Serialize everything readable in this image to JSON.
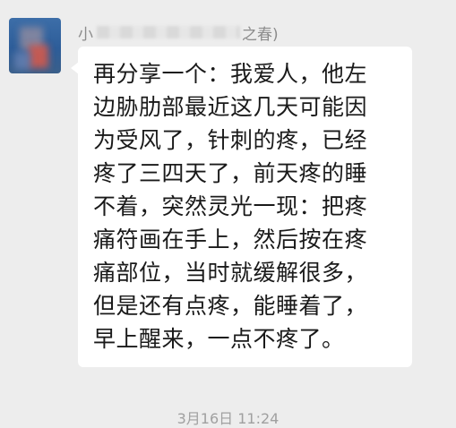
{
  "chat": {
    "sender": {
      "name_prefix": "小",
      "name_suffix": "之春)"
    },
    "message": {
      "lines": [
        "再分享一个：我爱人，他左",
        "边胁肋部最近这几天可能因",
        "为受风了，针刺的疼，已经",
        "疼了三四天了，前天疼的睡",
        "不着，突然灵光一现：把疼",
        "痛符画在手上，然后按在疼",
        "痛部位，当时就缓解很多，",
        "但是还有点疼，能睡着了，",
        "早上醒来，一点不疼了。"
      ]
    },
    "timestamp": "3月16日 11:24"
  }
}
